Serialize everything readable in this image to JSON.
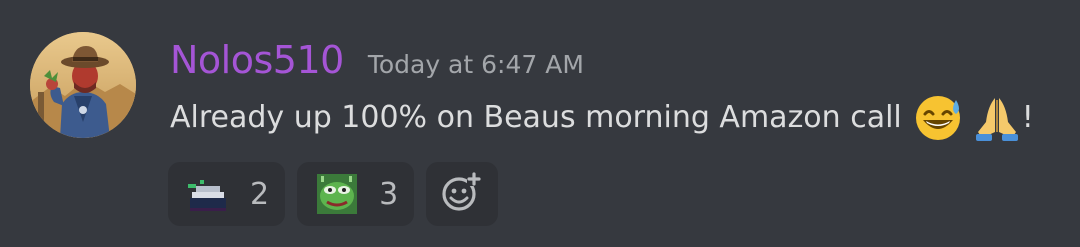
{
  "message": {
    "author": {
      "name": "Nolos510",
      "color": "#a555d6"
    },
    "timestamp": "Today at 6:47 AM",
    "text": "Already up 100% on Beaus morning Amazon call",
    "emojis": [
      "grinning-sweat-emoji",
      "folded-hands-emoji"
    ],
    "text_suffix": "!"
  },
  "reactions": [
    {
      "emoji": "money-stack-emoji",
      "count": "2"
    },
    {
      "emoji": "pepe-frog-emoji",
      "count": "3"
    }
  ],
  "add_reaction_icon": "add-reaction-icon",
  "colors": {
    "background": "#36393f",
    "reaction_bg": "#2f3136",
    "text": "#dcddde",
    "timestamp": "#a3a6aa",
    "count": "#b9bbbe"
  }
}
